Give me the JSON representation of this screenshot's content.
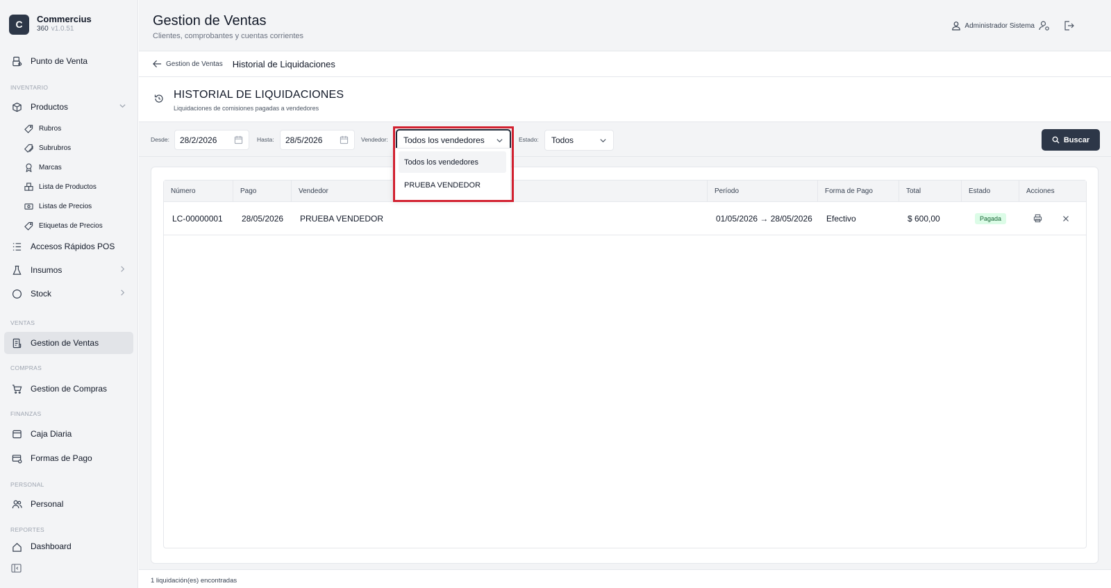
{
  "brand": {
    "initial": "C",
    "name": "Commercius",
    "product": "360",
    "version": "v1.0.51"
  },
  "sidebar": {
    "punto_venta": "Punto de Venta",
    "sec_inventario": "INVENTARIO",
    "productos": "Productos",
    "rubros": "Rubros",
    "subrubros": "Subrubros",
    "marcas": "Marcas",
    "lista_productos": "Lista de Productos",
    "listas_precios": "Listas de Precios",
    "etiquetas": "Etiquetas de Precios",
    "accesos": "Accesos Rápidos POS",
    "insumos": "Insumos",
    "stock": "Stock",
    "sec_ventas": "VENTAS",
    "gestion_ventas": "Gestion de Ventas",
    "sec_compras": "COMPRAS",
    "gestion_compras": "Gestion de Compras",
    "sec_finanzas": "FINANZAS",
    "caja": "Caja Diaria",
    "formas_pago": "Formas de Pago",
    "sec_personal": "PERSONAL",
    "personal": "Personal",
    "sec_reportes": "REPORTES",
    "dashboard": "Dashboard"
  },
  "header": {
    "title": "Gestion de Ventas",
    "subtitle": "Clientes, comprobantes y cuentas corrientes",
    "user": "Administrador Sistema"
  },
  "breadcrumb": {
    "back": "Gestion de Ventas",
    "current": "Historial de Liquidaciones"
  },
  "page": {
    "title": "HISTORIAL DE LIQUIDACIONES",
    "subtitle": "Liquidaciones de comisiones pagadas a vendedores"
  },
  "filters": {
    "desde_label": "Desde:",
    "desde_value": "28/2/2026",
    "hasta_label": "Hasta:",
    "hasta_value": "28/5/2026",
    "vendedor_label": "Vendedor:",
    "vendedor_value": "Todos los vendedores",
    "estado_label": "Estado:",
    "estado_value": "Todos",
    "buscar": "Buscar"
  },
  "dropdown": {
    "options": [
      "Todos los vendedores",
      "PRUEBA VENDEDOR"
    ]
  },
  "table": {
    "columns": [
      "Número",
      "Pago",
      "Vendedor",
      "Período",
      "Forma de Pago",
      "Total",
      "Estado",
      "Acciones"
    ],
    "rows": [
      {
        "numero": "LC-00000001",
        "pago": "28/05/2026",
        "vendedor": "PRUEBA VENDEDOR",
        "periodo": "01/05/2026 → 28/05/2026",
        "forma_pago": "Efectivo",
        "total": "$ 600,00",
        "estado": "Pagada"
      }
    ]
  },
  "footer": {
    "count_text": "1 liquidación(es) encontradas"
  },
  "colors": {
    "primary": "#2d3748",
    "highlight": "#d2202f",
    "badge_bg": "#dcfce7",
    "badge_text": "#166534"
  }
}
